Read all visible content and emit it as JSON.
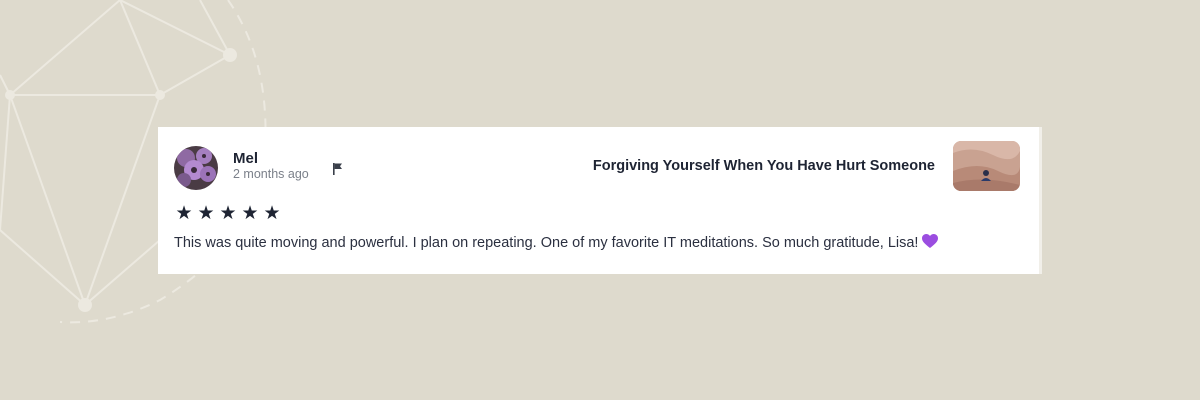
{
  "review": {
    "user_name": "Mel",
    "time_ago": "2 months ago",
    "course_title": "Forgiving Yourself When You Have Hurt Someone",
    "rating": 5,
    "stars": [
      "★",
      "★",
      "★",
      "★",
      "★"
    ],
    "text": "This was quite moving and powerful. I plan on repeating. One of my favorite IT meditations. So much gratitude, Lisa!",
    "emoji_icon": "purple-heart-icon"
  },
  "icons": {
    "flag": "flag-icon",
    "avatar": "avatar-flowers",
    "thumbnail": "course-thumbnail-desert"
  },
  "colors": {
    "page_background": "#dedacd",
    "card_background": "#ffffff",
    "text_primary": "#1e2433",
    "text_muted": "#7b808a",
    "heart": "#9b4de0"
  }
}
